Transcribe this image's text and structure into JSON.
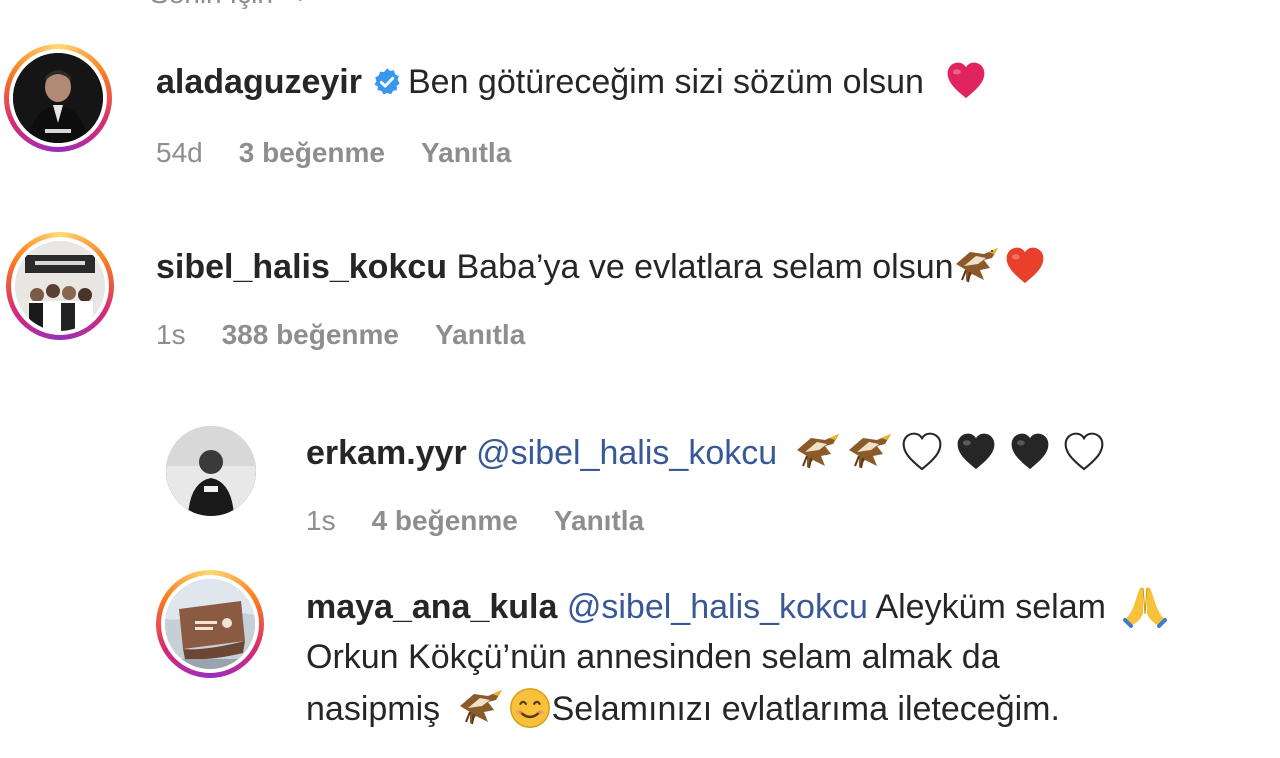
{
  "top_cut": {
    "label": "Senin İçin",
    "chevron": "chevron-down-icon"
  },
  "comments": [
    {
      "username": "aladaguzeyir",
      "verified": true,
      "text": "Ben götüreceğim sizi sözüm olsun",
      "time": "54d",
      "likes": "3 beğenme",
      "reply": "Yanıtla"
    },
    {
      "username": "sibel_halis_kokcu",
      "verified": false,
      "text": "Baba’ya ve evlatlara selam olsun",
      "time": "1s",
      "likes": "388 beğenme",
      "reply": "Yanıtla"
    }
  ],
  "replies": [
    {
      "username": "erkam.yyr",
      "mention": "@sibel_halis_kokcu",
      "text": "",
      "time": "1s",
      "likes": "4 beğenme",
      "reply": "Yanıtla"
    },
    {
      "username": "maya_ana_kula",
      "mention": "@sibel_halis_kokcu",
      "text_line1": "Aleyküm selam",
      "text_line2": "Orkun Kökçü’nün annesinden selam almak da",
      "text_line3_a": "nasipmiş",
      "text_line3_b": "Selamınızı evlatlarıma ileteceğim."
    }
  ],
  "colors": {
    "text": "#262626",
    "muted": "#8e8e8e",
    "mention": "#385898",
    "verified": "#3897f0",
    "heart_red": "#e0245e"
  }
}
